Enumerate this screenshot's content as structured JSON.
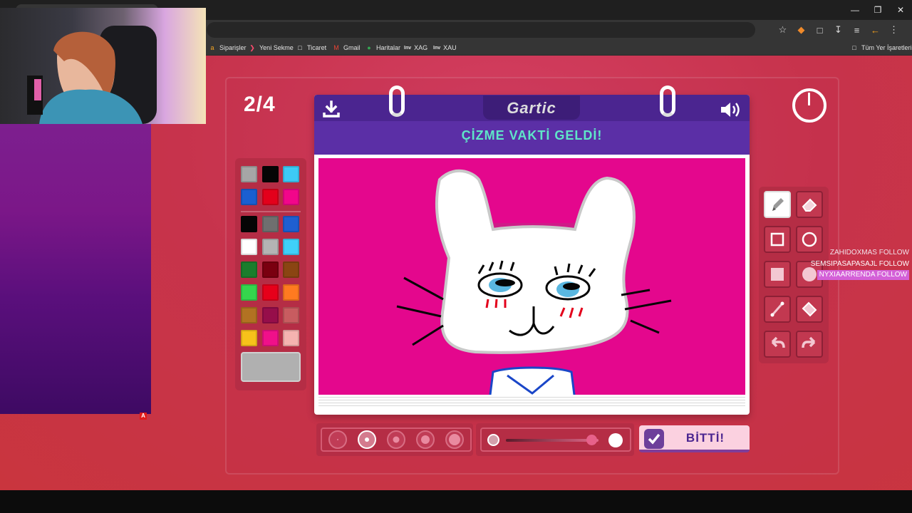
{
  "browser": {
    "bookmarks": [
      {
        "icon": "amazon-icon",
        "label": "Siparişler"
      },
      {
        "icon": "youtube-icon",
        "label": "Yeni Sekme"
      },
      {
        "icon": "folder-icon",
        "label": "Ticaret"
      },
      {
        "icon": "gmail-icon",
        "label": "Gmail"
      },
      {
        "icon": "maps-icon",
        "label": "Haritalar"
      },
      {
        "icon": "investing-icon",
        "label": "XAG"
      },
      {
        "icon": "investing-icon",
        "label": "XAU"
      }
    ],
    "all_bookmarks_label": "Tüm Yer İşaretleri",
    "inv_label": "Inv"
  },
  "game": {
    "round": "2/4",
    "logo": "Gartic",
    "prompt": "ÇİZME VAKTİ GELDİ!",
    "done_label": "BİTTİ!",
    "current_color": "#b0b0b0",
    "selected_brush_size_index": 1,
    "opacity_level": 0.92,
    "palette_top": [
      "#a6a6a6",
      "#050505",
      "#3dcaf6",
      "#1a5fd1",
      "#e3001b",
      "#f2068a"
    ],
    "palette_main": [
      "#050505",
      "#6f6f6f",
      "#1f5fd0",
      "#ffffff",
      "#b4b4b4",
      "#3fd0f9",
      "#1a7d2c",
      "#7a0010",
      "#8a4512",
      "#35d64d",
      "#e6001a",
      "#ff7a20",
      "#b27222",
      "#960e4a",
      "#c85c60",
      "#f7c21a",
      "#f0108a",
      "#f5b3b0"
    ],
    "tools": [
      "pencil-icon",
      "eraser-icon",
      "rectangle-icon",
      "circle-icon",
      "filled-rectangle-icon",
      "filled-circle-icon",
      "line-icon",
      "fill-bucket-icon",
      "undo-icon",
      "redo-icon"
    ],
    "active_tool": "pencil-icon"
  },
  "overlay": {
    "follows": [
      {
        "name": "ZAHIDOXMAS",
        "action": "FOLLOW"
      },
      {
        "name": "SEMSIPASAPASAJL",
        "action": "FOLLOW"
      },
      {
        "name": "NYXIAARRENDA",
        "action": "FOLLOW"
      }
    ],
    "alert_badge": "A"
  },
  "colors": {
    "accent_purple": "#4b2590",
    "prompt_teal": "#5fe6c8",
    "canvas_magenta": "#e4078d"
  }
}
